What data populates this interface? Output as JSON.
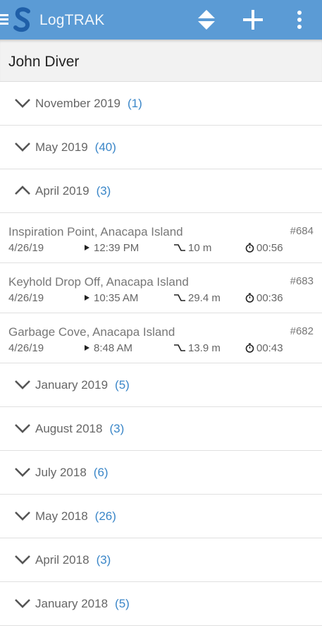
{
  "appbar": {
    "title": "LogTRAK",
    "icons": [
      "menu-icon",
      "scubapro-logo",
      "sort-icon",
      "add-icon",
      "more-icon"
    ],
    "background": "#5b9bd5"
  },
  "user": {
    "name": "John Diver"
  },
  "colors": {
    "accent": "#3a86c8",
    "muted": "#666666"
  },
  "groups": [
    {
      "label": "November 2019",
      "count": "(1)",
      "expanded": false
    },
    {
      "label": "May 2019",
      "count": "(40)",
      "expanded": false
    },
    {
      "label": "April 2019",
      "count": "(3)",
      "expanded": true,
      "dives": [
        {
          "site": "Inspiration Point, Anacapa Island",
          "number": "#684",
          "date": "4/26/19",
          "time": "12:39 PM",
          "depth": "10 m",
          "duration": "00:56"
        },
        {
          "site": "Keyhold Drop Off, Anacapa Island",
          "number": "#683",
          "date": "4/26/19",
          "time": "10:35 AM",
          "depth": "29.4 m",
          "duration": "00:36"
        },
        {
          "site": "Garbage Cove, Anacapa Island",
          "number": "#682",
          "date": "4/26/19",
          "time": "8:48 AM",
          "depth": "13.9 m",
          "duration": "00:43"
        }
      ]
    },
    {
      "label": "January 2019",
      "count": "(5)",
      "expanded": false
    },
    {
      "label": "August 2018",
      "count": "(3)",
      "expanded": false
    },
    {
      "label": "July 2018",
      "count": "(6)",
      "expanded": false
    },
    {
      "label": "May 2018",
      "count": "(26)",
      "expanded": false
    },
    {
      "label": "April 2018",
      "count": "(3)",
      "expanded": false
    },
    {
      "label": "January 2018",
      "count": "(5)",
      "expanded": false
    }
  ]
}
